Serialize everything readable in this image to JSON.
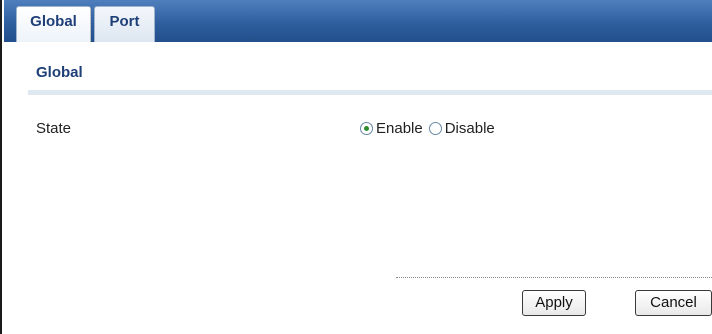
{
  "tabs": [
    {
      "label": "Global",
      "active": true
    },
    {
      "label": "Port",
      "active": false
    }
  ],
  "section": {
    "title": "Global"
  },
  "fields": {
    "state": {
      "label": "State",
      "options": [
        {
          "label": "Enable",
          "selected": true
        },
        {
          "label": "Disable",
          "selected": false
        }
      ]
    }
  },
  "buttons": {
    "apply_label": "Apply",
    "cancel_label": "Cancel"
  },
  "colors": {
    "tab_bar": "#2f5f9f",
    "accent_text": "#1f3f78",
    "radio_selected": "#2e8b2e"
  }
}
